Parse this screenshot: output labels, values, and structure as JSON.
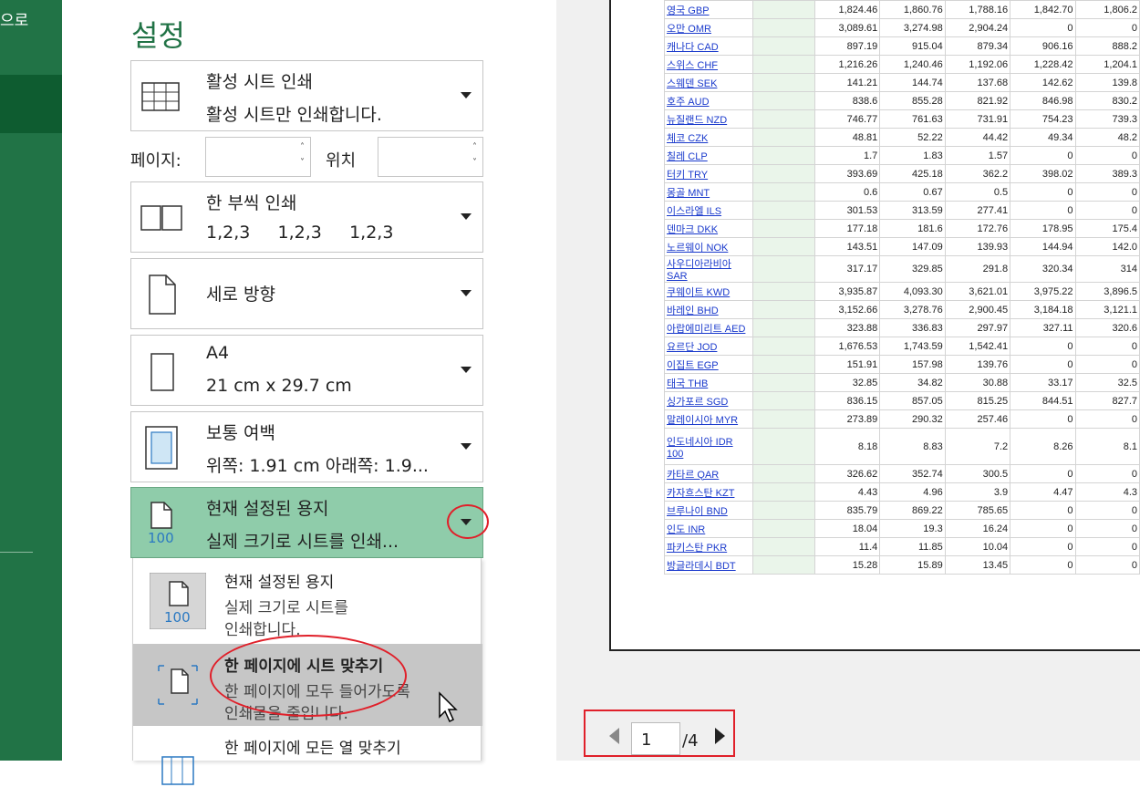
{
  "backstage": {
    "back_label": "으로"
  },
  "settings": {
    "title": "설정",
    "print_what": {
      "title": "활성 시트 인쇄",
      "subtitle": "활성 시트만 인쇄합니다."
    },
    "pages": {
      "pages_label": "페이지:",
      "to_label": "위치",
      "from_value": "",
      "to_value": ""
    },
    "collate": {
      "title": "한 부씩 인쇄",
      "subtitle": "1,2,3     1,2,3     1,2,3"
    },
    "orientation": {
      "title": "세로 방향"
    },
    "paper": {
      "title": "A4",
      "subtitle": "21 cm x 29.7 cm"
    },
    "margins": {
      "title": "보통 여백",
      "subtitle": "위쪽: 1.91 cm 아래쪽: 1.9..."
    },
    "scaling": {
      "title": "현재 설정된 용지",
      "subtitle": "실제 크기로 시트를 인쇄...",
      "icon_number": "100"
    }
  },
  "scaling_menu": [
    {
      "title": "현재 설정된 용지",
      "line1": "실제 크기로 시트를",
      "line2": "인쇄합니다.",
      "icon_number": "100"
    },
    {
      "title": "한 페이지에 시트 맞추기",
      "line1": "한 페이지에 모두 들어가도록",
      "line2": "인쇄물을 줄입니다."
    },
    {
      "title": "한 페이지에 모든 열 맞추기",
      "line1": "",
      "line2": ""
    }
  ],
  "preview_table": {
    "rows": [
      [
        "영국 GBP",
        "1,824.46",
        "1,860.76",
        "1,788.16",
        "1,842.70",
        "1,806.2"
      ],
      [
        "오만 OMR",
        "3,089.61",
        "3,274.98",
        "2,904.24",
        "0",
        "0"
      ],
      [
        "캐나다 CAD",
        "897.19",
        "915.04",
        "879.34",
        "906.16",
        "888.2"
      ],
      [
        "스위스 CHF",
        "1,216.26",
        "1,240.46",
        "1,192.06",
        "1,228.42",
        "1,204.1"
      ],
      [
        "스웨덴 SEK",
        "141.21",
        "144.74",
        "137.68",
        "142.62",
        "139.8"
      ],
      [
        "호주 AUD",
        "838.6",
        "855.28",
        "821.92",
        "846.98",
        "830.2"
      ],
      [
        "뉴질랜드 NZD",
        "746.77",
        "761.63",
        "731.91",
        "754.23",
        "739.3"
      ],
      [
        "체코 CZK",
        "48.81",
        "52.22",
        "44.42",
        "49.34",
        "48.2"
      ],
      [
        "칠레 CLP",
        "1.7",
        "1.83",
        "1.57",
        "0",
        "0"
      ],
      [
        "터키 TRY",
        "393.69",
        "425.18",
        "362.2",
        "398.02",
        "389.3"
      ],
      [
        "몽골 MNT",
        "0.6",
        "0.67",
        "0.5",
        "0",
        "0"
      ],
      [
        "이스라엘 ILS",
        "301.53",
        "313.59",
        "277.41",
        "0",
        "0"
      ],
      [
        "덴마크 DKK",
        "177.18",
        "181.6",
        "172.76",
        "178.95",
        "175.4"
      ],
      [
        "노르웨이 NOK",
        "143.51",
        "147.09",
        "139.93",
        "144.94",
        "142.0"
      ],
      [
        "사우디아라비아 SAR",
        "317.17",
        "329.85",
        "291.8",
        "320.34",
        "314"
      ],
      [
        "쿠웨이트 KWD",
        "3,935.87",
        "4,093.30",
        "3,621.01",
        "3,975.22",
        "3,896.5"
      ],
      [
        "바레인 BHD",
        "3,152.66",
        "3,278.76",
        "2,900.45",
        "3,184.18",
        "3,121.1"
      ],
      [
        "아랍에미리트 AED",
        "323.88",
        "336.83",
        "297.97",
        "327.11",
        "320.6"
      ],
      [
        "요르단 JOD",
        "1,676.53",
        "1,743.59",
        "1,542.41",
        "0",
        "0"
      ],
      [
        "이집트 EGP",
        "151.91",
        "157.98",
        "139.76",
        "0",
        "0"
      ],
      [
        "태국 THB",
        "32.85",
        "34.82",
        "30.88",
        "33.17",
        "32.5"
      ],
      [
        "싱가포르 SGD",
        "836.15",
        "857.05",
        "815.25",
        "844.51",
        "827.7"
      ],
      [
        "말레이시아 MYR",
        "273.89",
        "290.32",
        "257.46",
        "0",
        "0"
      ],
      [
        "인도네시아 IDR 100",
        "8.18",
        "8.83",
        "7.2",
        "8.26",
        "8.1"
      ],
      [
        "카타르 QAR",
        "326.62",
        "352.74",
        "300.5",
        "0",
        "0"
      ],
      [
        "카자흐스탄 KZT",
        "4.43",
        "4.96",
        "3.9",
        "4.47",
        "4.3"
      ],
      [
        "브루나이 BND",
        "835.79",
        "869.22",
        "785.65",
        "0",
        "0"
      ],
      [
        "인도 INR",
        "18.04",
        "19.3",
        "16.24",
        "0",
        "0"
      ],
      [
        "파키스탄 PKR",
        "11.4",
        "11.85",
        "10.04",
        "0",
        "0"
      ],
      [
        "방글라데시 BDT",
        "15.28",
        "15.89",
        "13.45",
        "0",
        "0"
      ]
    ]
  },
  "pager": {
    "current": "1",
    "total": "/4"
  },
  "colors": {
    "excel_green": "#217346",
    "annotation_red": "#e0202a",
    "link_blue": "#1a3acc"
  }
}
